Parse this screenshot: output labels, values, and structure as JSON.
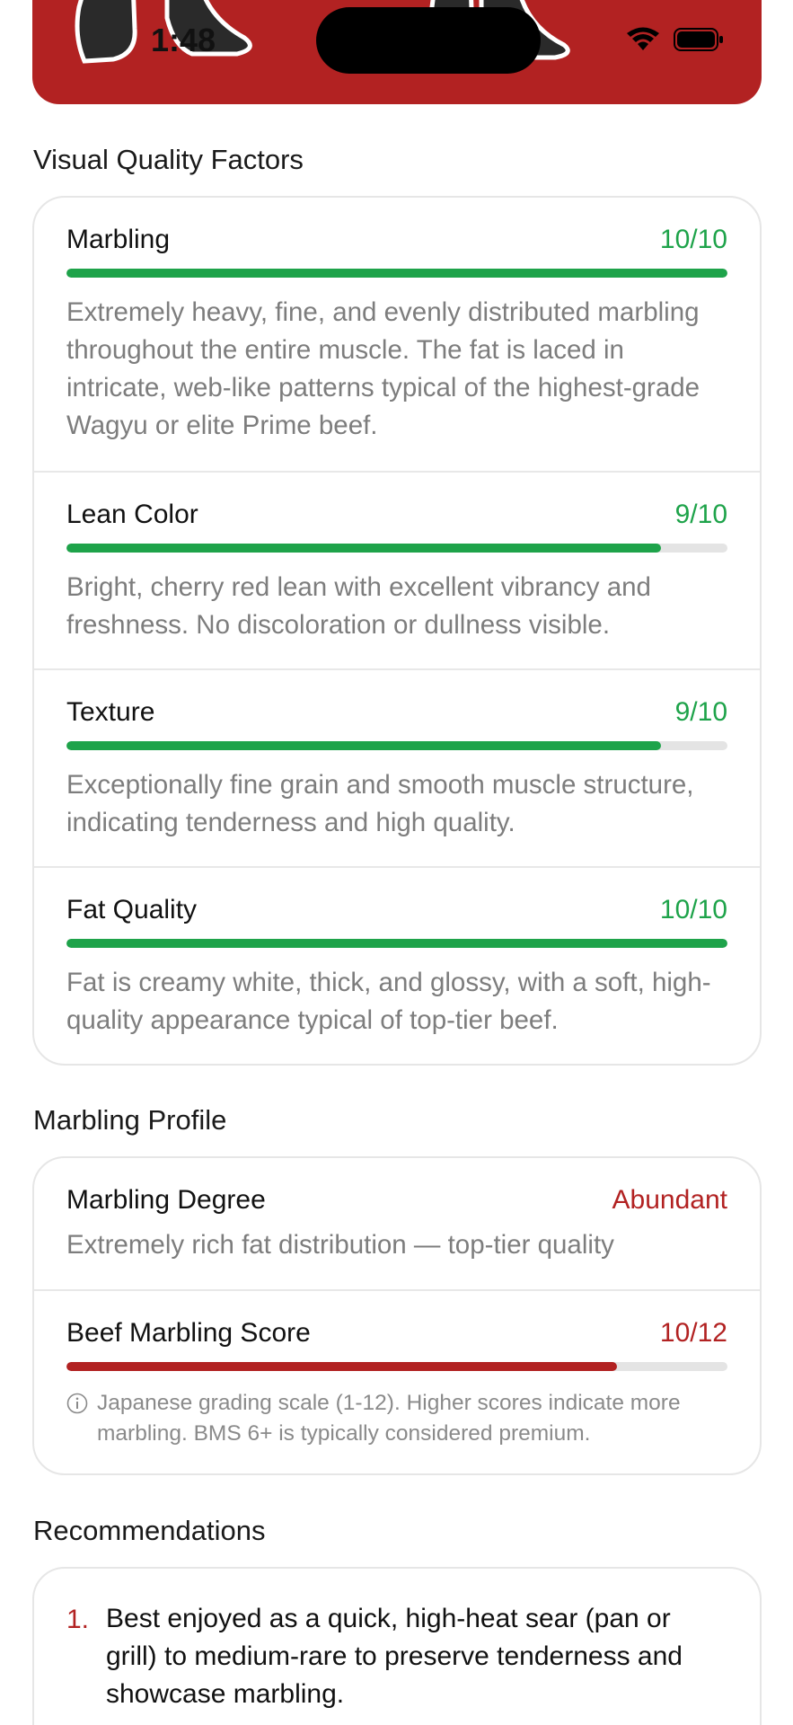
{
  "status_bar": {
    "time": "1:48"
  },
  "colors": {
    "accent_red": "#b22222",
    "score_green": "#1ea34a",
    "muted_text": "#7d7d7d"
  },
  "visual_quality": {
    "title": "Visual Quality Factors",
    "factors": [
      {
        "name": "Marbling",
        "score": "10/10",
        "level": 1.0,
        "description": "Extremely heavy, fine, and evenly distributed marbling throughout the entire muscle. The fat is laced in intricate, web-like patterns typical of the highest-grade Wagyu or elite Prime beef."
      },
      {
        "name": "Lean Color",
        "score": "9/10",
        "level": 0.9,
        "description": "Bright, cherry red lean with excellent vibrancy and freshness. No discoloration or dullness visible."
      },
      {
        "name": "Texture",
        "score": "9/10",
        "level": 0.9,
        "description": "Exceptionally fine grain and smooth muscle structure, indicating tenderness and high quality."
      },
      {
        "name": "Fat Quality",
        "score": "10/10",
        "level": 1.0,
        "description": "Fat is creamy white, thick, and glossy, with a soft, high-quality appearance typical of top-tier beef."
      }
    ]
  },
  "marbling_profile": {
    "title": "Marbling Profile",
    "degree_label": "Marbling Degree",
    "degree_value": "Abundant",
    "degree_description": "Extremely rich fat distribution — top-tier quality",
    "bms_label": "Beef Marbling Score",
    "bms_score": "10/12",
    "bms_level": 0.8333,
    "bms_note": "Japanese grading scale (1-12). Higher scores indicate more marbling. BMS 6+ is typically considered premium.",
    "info_icon": "info-circle-icon"
  },
  "recommendations": {
    "title": "Recommendations",
    "items": [
      {
        "number": "1.",
        "text": "Best enjoyed as a quick, high-heat sear (pan or grill) to medium-rare to preserve tenderness and showcase marbling."
      }
    ]
  }
}
